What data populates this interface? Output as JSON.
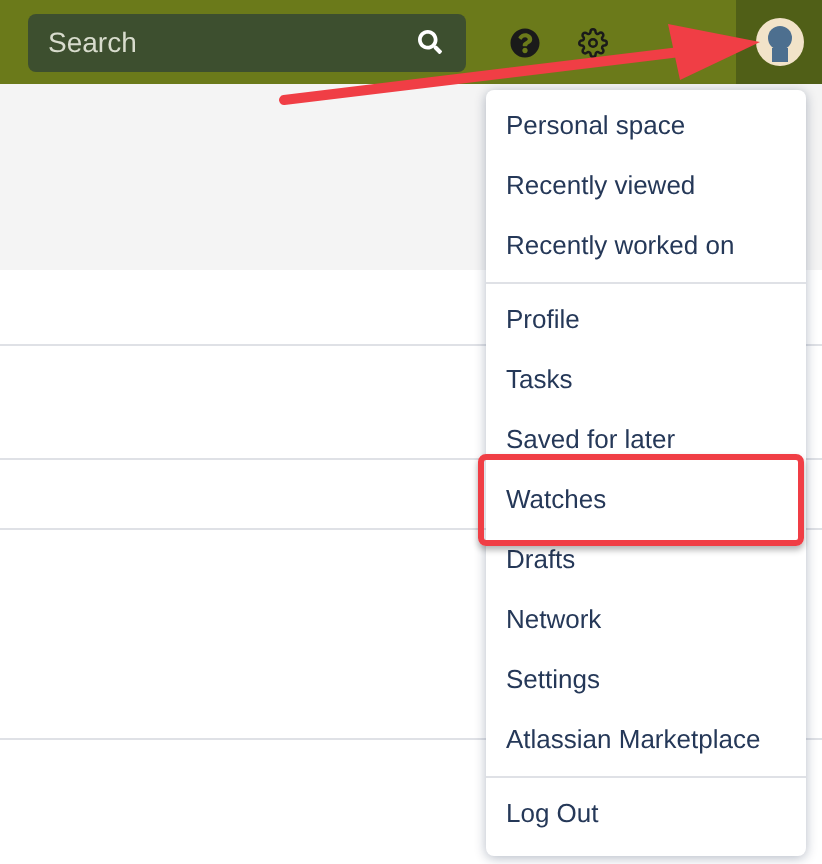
{
  "top_bar": {
    "search": {
      "placeholder": "Search"
    }
  },
  "user_menu": {
    "groups": [
      {
        "items": [
          {
            "label": "Personal space",
            "highlighted": false
          },
          {
            "label": "Recently viewed",
            "highlighted": false
          },
          {
            "label": "Recently worked on",
            "highlighted": false
          }
        ]
      },
      {
        "items": [
          {
            "label": "Profile",
            "highlighted": false
          },
          {
            "label": "Tasks",
            "highlighted": false
          },
          {
            "label": "Saved for later",
            "highlighted": false
          },
          {
            "label": "Watches",
            "highlighted": true
          },
          {
            "label": "Drafts",
            "highlighted": false
          },
          {
            "label": "Network",
            "highlighted": false
          },
          {
            "label": "Settings",
            "highlighted": false
          },
          {
            "label": "Atlassian Marketplace",
            "highlighted": false
          }
        ]
      },
      {
        "items": [
          {
            "label": "Log Out",
            "highlighted": false
          }
        ]
      }
    ]
  }
}
